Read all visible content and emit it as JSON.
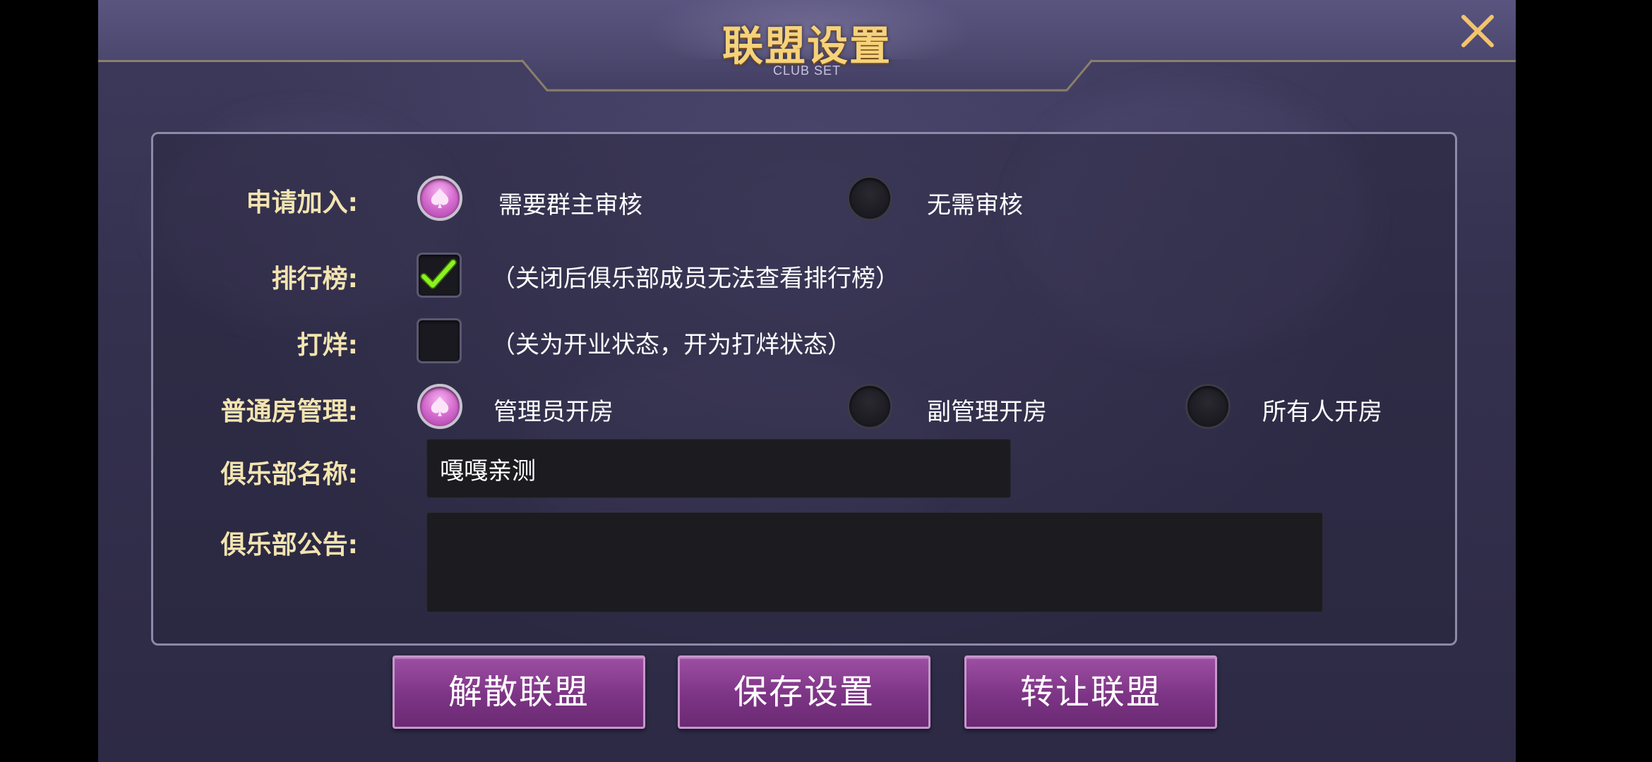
{
  "dialog": {
    "title": "联盟设置",
    "subtitle": "CLUB SET",
    "close_icon": "close-icon"
  },
  "settings": {
    "join": {
      "label": "申请加入:",
      "options": [
        {
          "label": "需要群主审核",
          "selected": true
        },
        {
          "label": "无需审核",
          "selected": false
        }
      ]
    },
    "ranking": {
      "label": "排行榜:",
      "checked": true,
      "note": "（关闭后俱乐部成员无法查看排行榜）"
    },
    "closing": {
      "label": "打烊:",
      "checked": false,
      "note": "（关为开业状态，开为打烊状态）"
    },
    "room_management": {
      "label": "普通房管理:",
      "options": [
        {
          "label": "管理员开房",
          "selected": true
        },
        {
          "label": "副管理开房",
          "selected": false
        },
        {
          "label": "所有人开房",
          "selected": false
        }
      ]
    },
    "club_name": {
      "label": "俱乐部名称:",
      "value": "嘎嘎亲测"
    },
    "club_notice": {
      "label": "俱乐部公告:",
      "value": ""
    }
  },
  "actions": {
    "dissolve": "解散联盟",
    "save": "保存设置",
    "transfer": "转让联盟"
  },
  "colors": {
    "title_gold": "#f6d27a",
    "label_cream": "#f3e4b0",
    "button_purple": "#7d3485",
    "radio_pink": "#d66fd0",
    "check_green": "#8cf21e"
  }
}
